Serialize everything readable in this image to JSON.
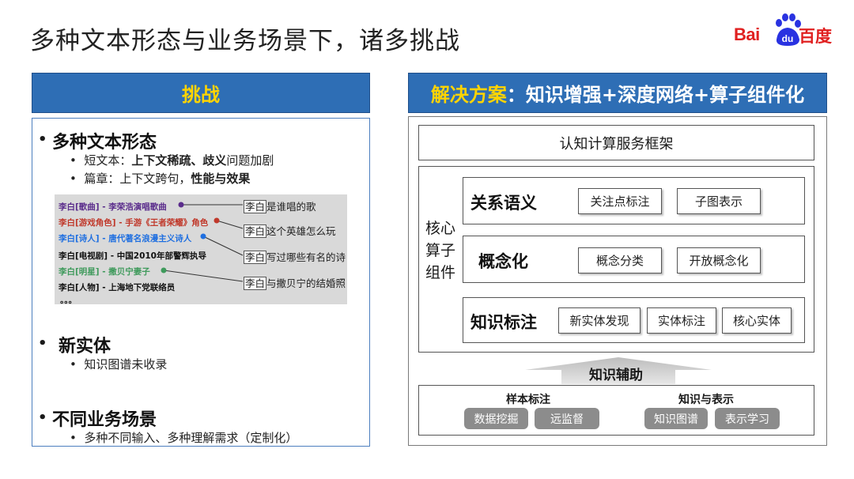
{
  "slide": {
    "title": "多种文本形态与业务场景下，诸多挑战"
  },
  "logo": {
    "latin": "Bai",
    "du": "du",
    "chinese": "百度"
  },
  "challenges": {
    "header": "挑战",
    "items": [
      {
        "heading": "多种文本形态",
        "subs": [
          {
            "prefix": "短文本：",
            "bold": "上下文稀疏、歧义",
            "suffix": "问题加剧"
          },
          {
            "prefix": "篇章：上下文跨句，",
            "bold": "性能与效果",
            "suffix": ""
          }
        ]
      },
      {
        "heading": "新实体",
        "subs": [
          {
            "prefix": "知识图谱未收录",
            "bold": "",
            "suffix": ""
          }
        ]
      },
      {
        "heading": "不同业务场景",
        "subs": [
          {
            "prefix": "多种不同输入、多种理解需求（定制化）",
            "bold": "",
            "suffix": ""
          }
        ]
      }
    ],
    "example": {
      "entries": [
        {
          "text": "李白[歌曲] - 李荣浩演唱歌曲",
          "color": "#5b2d8c"
        },
        {
          "text": "李白[游戏角色] - 手游《王者荣耀》角色",
          "color": "#c0392b"
        },
        {
          "text": "李白[诗人] - 唐代著名浪漫主义诗人",
          "color": "#1f6fe0"
        },
        {
          "text": "李白[电视剧] - 中国2010年部警辉执导",
          "color": "#111111"
        },
        {
          "text": "李白[明星] - 撒贝宁妻子",
          "color": "#3f9a5c"
        },
        {
          "text": "李白[人物] - 上海地下党联络员",
          "color": "#111111"
        }
      ],
      "ellipsis": "。。。",
      "queries": [
        {
          "name": "李白",
          "rest": "是谁唱的歌"
        },
        {
          "name": "李白",
          "rest": "这个英雄怎么玩"
        },
        {
          "name": "李白",
          "rest": "写过哪些有名的诗"
        },
        {
          "name": "李白",
          "rest": "与撒贝宁的结婚照"
        }
      ]
    }
  },
  "solution": {
    "header_yellow": "解决方案",
    "header_white": "：知识增强+深度网络+算子组件化",
    "framework": "认知计算服务框架",
    "core_label": [
      "核心",
      "算子",
      "组件"
    ],
    "rows": [
      {
        "label": "关系语义",
        "chips": [
          "关注点标注",
          "子图表示"
        ]
      },
      {
        "label": "概念化",
        "chips": [
          "概念分类",
          "开放概念化"
        ]
      },
      {
        "label": "知识标注",
        "chips": [
          "新实体发现",
          "实体标注",
          "核心实体"
        ]
      }
    ],
    "aid_label": "知识辅助",
    "bottom": {
      "left_title": "样本标注",
      "left_pills": [
        "数据挖掘",
        "远监督"
      ],
      "right_title": "知识与表示",
      "right_pills": [
        "知识图谱",
        "表示学习"
      ]
    }
  },
  "colors": {
    "accent_blue": "#2e6eb5",
    "header_yellow": "#ffd400",
    "logo_red": "#e02020",
    "logo_blue": "#2932e1"
  }
}
